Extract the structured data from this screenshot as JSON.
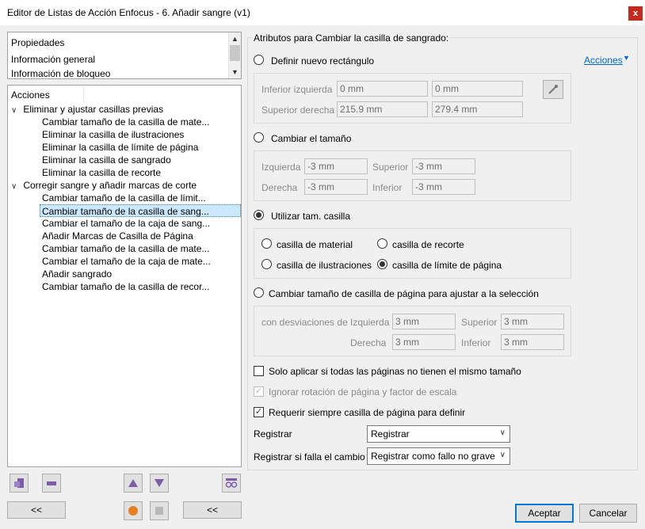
{
  "window": {
    "title": "Editor de Listas de Acción Enfocus - 6. Añadir sangre (v1)",
    "close_label": "x"
  },
  "properties_panel": {
    "header": "Propiedades",
    "items": [
      "Información general",
      "Información de bloqueo"
    ]
  },
  "actions_panel": {
    "header": "Acciones",
    "groups": [
      {
        "label": "Eliminar y ajustar casillas previas",
        "items": [
          "Cambiar tamaño de la casilla de mate...",
          "Eliminar la casilla de ilustraciones",
          "Eliminar la casilla de límite de página",
          "Eliminar la casilla de sangrado",
          "Eliminar la casilla de recorte"
        ]
      },
      {
        "label": "Corregir sangre y añadir marcas de corte",
        "items": [
          "Cambiar tamaño de la casilla de límit...",
          "Cambiar tamaño de la casilla de sang...",
          "Cambiar el tamaño de la caja de sang...",
          "Añadir Marcas de Casilla de Página",
          "Cambiar tamaño de la casilla de mate...",
          "Cambiar el tamaño de la caja de mate...",
          "Añadir sangrado",
          "Cambiar tamaño de la casilla de recor..."
        ]
      }
    ]
  },
  "right": {
    "section_title": "Atributos para Cambiar la casilla de sangrado:",
    "acciones_link": "Acciones",
    "opt_define_rect": "Definir nuevo rectángulo",
    "lower_left_label": "Inferior izquierda",
    "lower_left_x": "0 mm",
    "lower_left_y": "0 mm",
    "upper_right_label": "Superior derecha",
    "upper_right_x": "215.9 mm",
    "upper_right_y": "279.4 mm",
    "opt_resize": "Cambiar el tamaño",
    "left_label": "Izquierda",
    "left_val": "-3 mm",
    "top_label": "Superior",
    "top_val": "-3 mm",
    "right_label": "Derecha",
    "right_val": "-3 mm",
    "bottom_label": "Inferior",
    "bottom_val": "-3 mm",
    "opt_use_box": "Utilizar tam. casilla",
    "box_media": "casilla de material",
    "box_trim": "casilla de recorte",
    "box_art": "casilla de ilustraciones",
    "box_bleed": "casilla de límite de página",
    "opt_fit_selection": "Cambiar tamaño de casilla de página para ajustar a la selección",
    "offsets_label": "con desviaciones de",
    "off_left_label": "Izquierda",
    "off_left_val": "3 mm",
    "off_top_label": "Superior",
    "off_top_val": "3 mm",
    "off_right_label": "Derecha",
    "off_right_val": "3 mm",
    "off_bottom_label": "Inferior",
    "off_bottom_val": "3 mm",
    "chk_only_if_diff": "Solo aplicar si todas las páginas no tienen el mismo tamaño",
    "chk_ignore_rotation": "Ignorar rotación de página y factor de escala",
    "chk_require_box": "Requerir siempre casilla de página para definir",
    "log_label": "Registrar",
    "log_value": "Registrar",
    "log_fail_label": "Registrar si falla el cambio",
    "log_fail_value": "Registrar como fallo no grave"
  },
  "footer": {
    "back_left": "<<",
    "back_right": "<<",
    "ok": "Aceptar",
    "cancel": "Cancelar"
  }
}
